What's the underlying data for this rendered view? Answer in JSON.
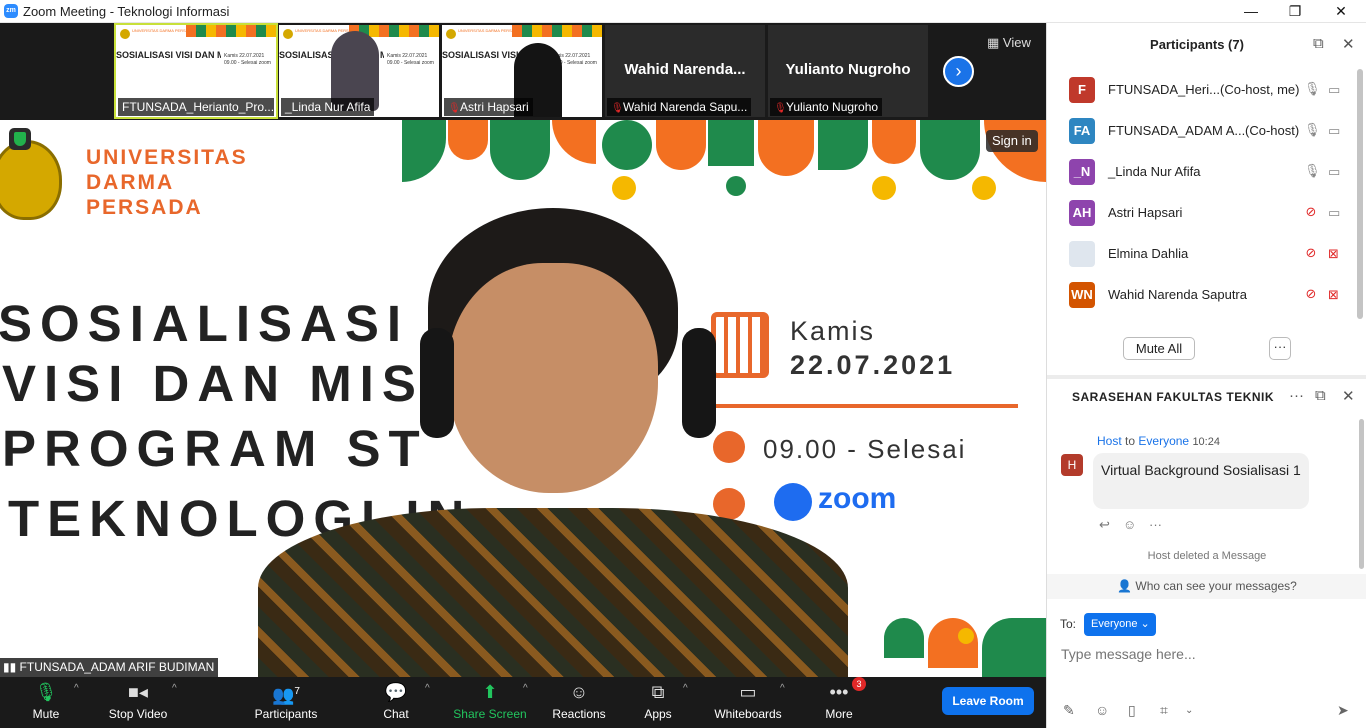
{
  "window": {
    "title": "Zoom Meeting - Teknologi Informasi",
    "logo_text": "zm"
  },
  "gallery": {
    "tiles": [
      {
        "name": "FTUNSADA_Herianto_Pro..."
      },
      {
        "name": "_Linda Nur Afifa"
      },
      {
        "name": "Astri Hapsari"
      },
      {
        "big_name": "Wahid  Narenda...",
        "name": "Wahid Narenda Sapu..."
      },
      {
        "big_name": "Yulianto Nugroho",
        "name": "Yulianto Nugroho"
      }
    ],
    "view_label": "View"
  },
  "mini": {
    "head": "UNIVERSITAS DARMA PERSADA",
    "lines": "SOSIALISASI VISI DAN MISI PROGRAM STUDI TEKNOLOGI INFORM",
    "date": "Kamis 22.07.2021 09.00 - Selesai zoom"
  },
  "main_video": {
    "sign_in": "Sign in",
    "uni_name_1": "UNIVERSITAS",
    "uni_name_2": "DARMA",
    "uni_name_3": "PERSADA",
    "line1": "SOSIALISASI",
    "line2": "VISI DAN MIS",
    "line3": "PROGRAM ST",
    "line4": "TEKNOLOGI IN",
    "day": "Kamis",
    "date": "22.07.2021",
    "time": "09.00 - Selesai",
    "platform": "zoom",
    "speaker_name": "FTUNSADA_ADAM ARIF BUDIMAN"
  },
  "toolbar": {
    "mute": "Mute",
    "stop_video": "Stop Video",
    "participants": "Participants",
    "participants_count": "7",
    "chat": "Chat",
    "share_screen": "Share Screen",
    "reactions": "Reactions",
    "apps": "Apps",
    "whiteboards": "Whiteboards",
    "more": "More",
    "more_badge": "3",
    "leave": "Leave Room"
  },
  "participants_panel": {
    "title": "Participants (7)",
    "list": [
      {
        "initials": "F",
        "name": "FTUNSADA_Heri...",
        "role": "(Co-host, me)",
        "color": "#c0392b",
        "mic_muted": false,
        "cam_off": false
      },
      {
        "initials": "FA",
        "name": "FTUNSADA_ADAM A...",
        "role": "(Co-host)",
        "color": "#2e86c1",
        "mic_muted": false,
        "cam_off": false
      },
      {
        "initials": "_N",
        "name": "_Linda Nur Afifa",
        "role": "",
        "color": "#8e44ad",
        "mic_muted": false,
        "cam_off": false
      },
      {
        "initials": "AH",
        "name": "Astri Hapsari",
        "role": "",
        "color": "#8e44ad",
        "mic_muted": true,
        "cam_off": false
      },
      {
        "initials": "",
        "name": "Elmina Dahlia",
        "role": "",
        "color": "#dfe6ee",
        "mic_muted": true,
        "cam_off": true
      },
      {
        "initials": "WN",
        "name": "Wahid Narenda Saputra",
        "role": "",
        "color": "#d35400",
        "mic_muted": true,
        "cam_off": true
      }
    ],
    "mute_all": "Mute All",
    "more": "···"
  },
  "chat_panel": {
    "title": "SARASEHAN FAKULTAS TEKNIK",
    "message": {
      "sender": "Host",
      "to_word": "to",
      "recipient": "Everyone",
      "time": "10:24",
      "avatar": "H",
      "text": "Virtual Background Sosialisasi 1"
    },
    "deleted_notice": "Host deleted a Message",
    "who_can_see": "Who can see your messages?",
    "to_label": "To:",
    "to_value": "Everyone",
    "input_placeholder": "Type message here..."
  },
  "colors": {
    "accent": "#0e72ed",
    "orange": "#e8672b",
    "green": "#1f8a4c",
    "yellow": "#f5b800",
    "danger": "#e02828"
  }
}
